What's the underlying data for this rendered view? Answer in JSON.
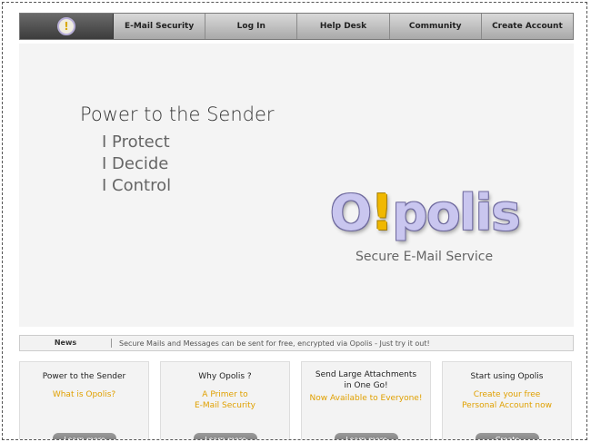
{
  "nav": {
    "logo_symbol": "!",
    "items": [
      "E-Mail Security",
      "Log In",
      "Help Desk",
      "Community",
      "Create Account"
    ]
  },
  "hero": {
    "title": "Power to the Sender",
    "lines": [
      "I Protect",
      "I Decide",
      "I Control"
    ],
    "brand_pre": "O",
    "brand_bang": "!",
    "brand_post": "polis",
    "tagline": "Secure E-Mail Service"
  },
  "news": {
    "label": "News",
    "text": "Secure Mails and Messages can be sent for free, encrypted via Opolis - Just try it out!"
  },
  "cards": [
    {
      "title": "Power to the Sender",
      "sub": "What is Opolis?",
      "button": "Learn more"
    },
    {
      "title": "Why Opolis ?",
      "sub": "A Primer to\nE-Mail Security",
      "button": "Learn more"
    },
    {
      "title": "Send Large Attachments\nin One Go!",
      "sub": "Now Available to Everyone!",
      "button": "Learn more"
    },
    {
      "title": "Start using Opolis",
      "sub": "Create your free\nPersonal Account now",
      "button": "Create"
    }
  ],
  "colors": {
    "accent": "#e0a000",
    "brand_purple": "#c9c6ef"
  }
}
